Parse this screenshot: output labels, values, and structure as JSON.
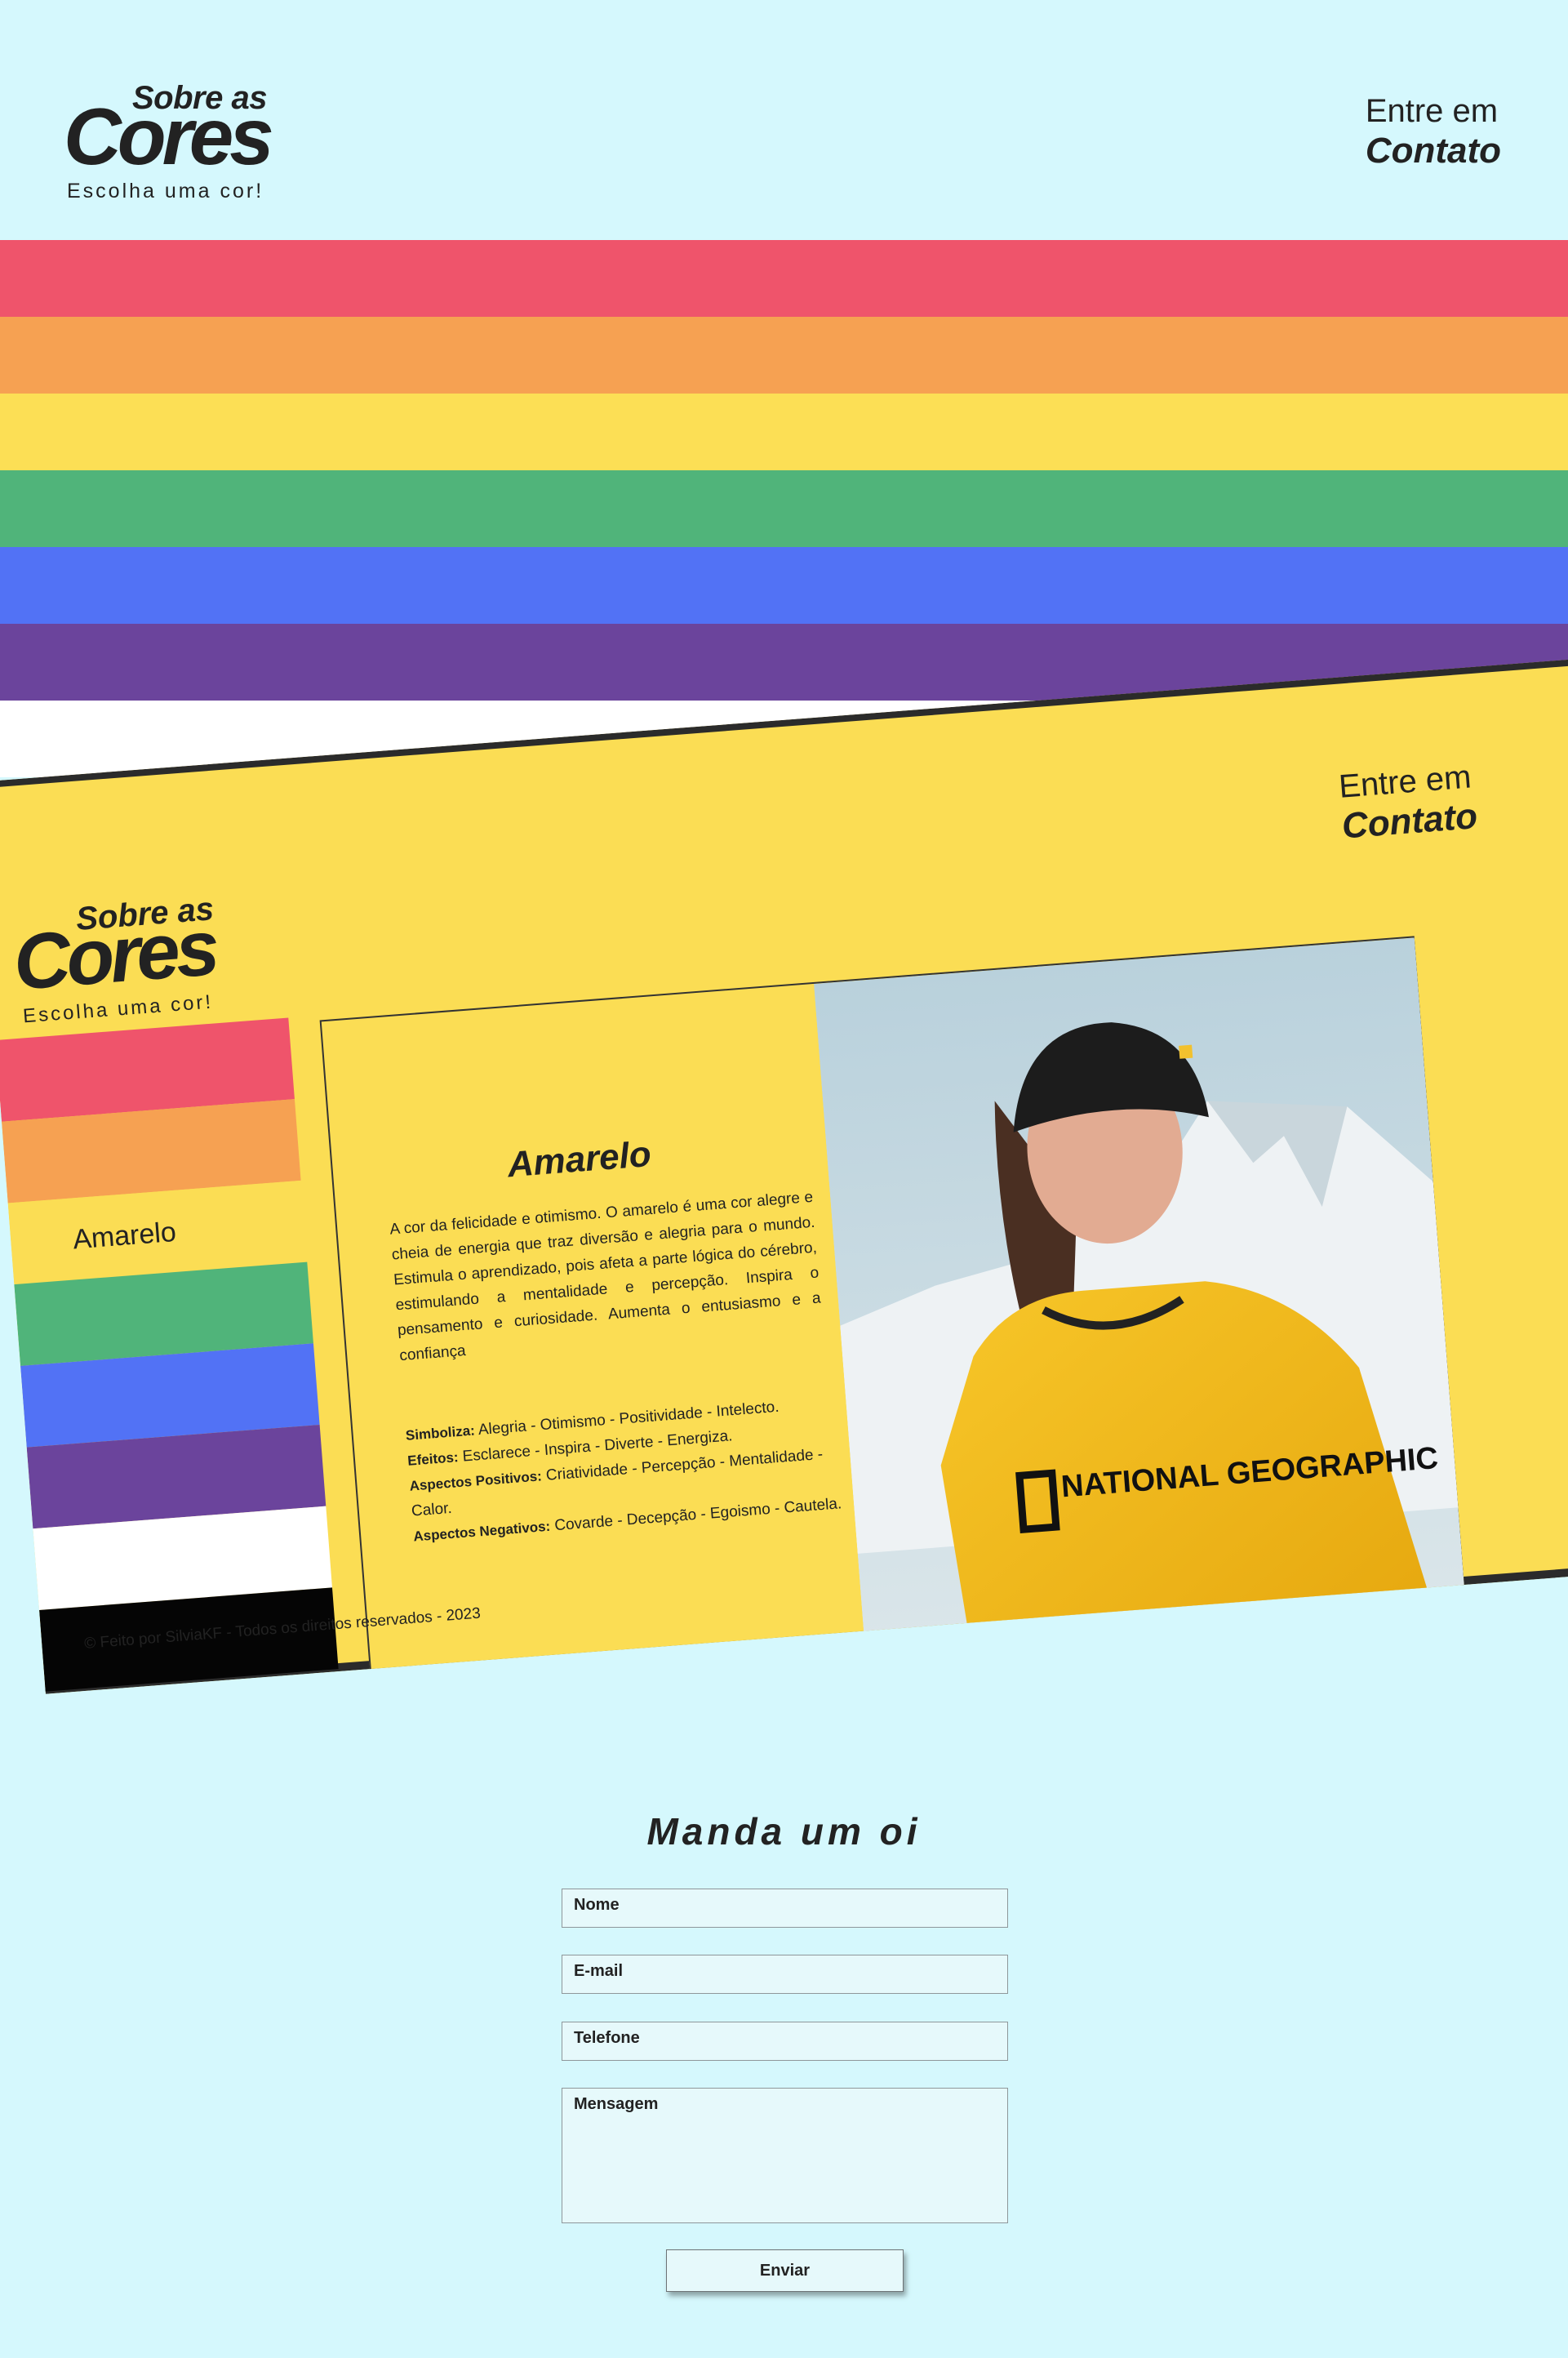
{
  "header": {
    "logo": {
      "top": "Sobre as",
      "main": "Cores",
      "subtitle": "Escolha uma cor!"
    },
    "contact": {
      "line1": "Entre em",
      "line2": "Contato"
    }
  },
  "stripes": [
    {
      "name": "vermelho",
      "color": "#ef546b"
    },
    {
      "name": "laranja",
      "color": "#f6a152"
    },
    {
      "name": "amarelo",
      "color": "#fcdf55"
    },
    {
      "name": "verde",
      "color": "#50b47a"
    },
    {
      "name": "azul",
      "color": "#5272f5"
    },
    {
      "name": "roxo",
      "color": "#6b449c"
    }
  ],
  "preview": {
    "logo": {
      "top": "Sobre as",
      "main": "Cores",
      "subtitle": "Escolha uma cor!"
    },
    "contact": {
      "line1": "Entre em",
      "line2": "Contato"
    },
    "background_color": "#fbdd54",
    "side_stripes": [
      {
        "color": "#ef546b",
        "label": ""
      },
      {
        "color": "#f6a152",
        "label": ""
      },
      {
        "color": "#fbdd54",
        "label": "Amarelo"
      },
      {
        "color": "#50b47a",
        "label": ""
      },
      {
        "color": "#5272f5",
        "label": ""
      },
      {
        "color": "#6b449c",
        "label": ""
      },
      {
        "color": "#ffffff",
        "label": ""
      },
      {
        "color": "#050505",
        "label": ""
      }
    ],
    "panel": {
      "title": "Amarelo",
      "body": "A cor da felicidade e otimismo. O amarelo é uma cor alegre e cheia de energia que traz diversão e alegria para o mundo. Estimula o aprendizado, pois afeta a parte lógica do cérebro, estimulando a mentalidade e percepção. Inspira o pensamento e curiosidade. Aumenta o entusiasmo e a confiança",
      "props": [
        {
          "label": "Simboliza:",
          "value": "Alegria - Otimismo - Positividade - Intelecto."
        },
        {
          "label": "Efeitos:",
          "value": "Esclarece - Inspira - Diverte - Energiza."
        },
        {
          "label": "Aspectos Positivos:",
          "value": "Criatividade - Percepção - Mentalidade - Calor."
        },
        {
          "label": "Aspectos Negativos:",
          "value": "Covarde - Decepção - Egoismo - Cautela."
        }
      ],
      "photo": {
        "hoodie_text": "NATIONAL GEOGRAPHIC"
      }
    },
    "instagram_icon": "instagram-icon",
    "footer": "© Feito por SilviaKF - Todos os direitos reservados - 2023"
  },
  "form": {
    "title": "Manda um oi",
    "fields": {
      "nome": "Nome",
      "email": "E-mail",
      "telefone": "Telefone",
      "mensagem": "Mensagem"
    },
    "submit": "Enviar"
  }
}
